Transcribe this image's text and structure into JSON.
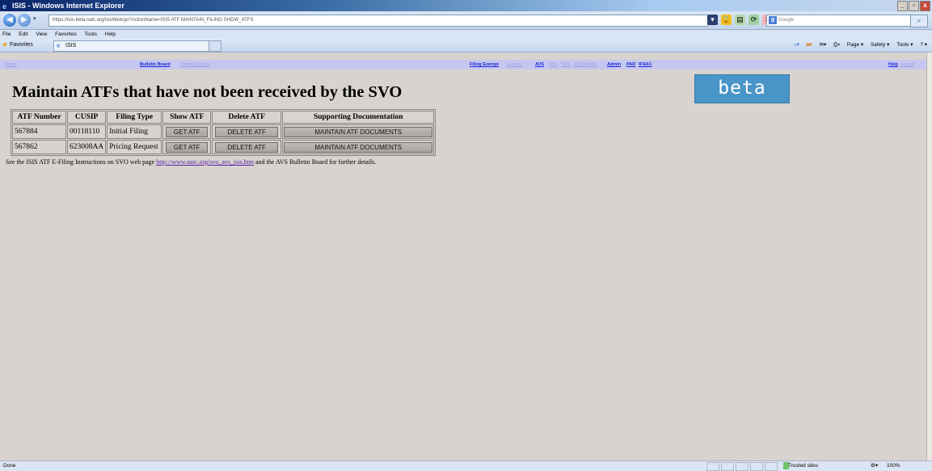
{
  "window": {
    "title": "ISIS - Windows Internet Explorer",
    "min": "_",
    "max": "▫",
    "close": "x"
  },
  "address_bar": {
    "url": "https://isis-beta.naic.org/isisWeb/go?ActionName=ISIS ATF MAINTAIN_FILING SHOW_ATFS",
    "search_placeholder": "Google",
    "search_logo": "g"
  },
  "menu": [
    "File",
    "Edit",
    "View",
    "Favorites",
    "Tools",
    "Help"
  ],
  "favorites_bar": {
    "favorites_label": "Favorites",
    "tab_label": "ISIS",
    "commands": [
      "Page ▾",
      "Safety ▾",
      "Tools ▾",
      "? ▾"
    ]
  },
  "nav": {
    "home": "Home",
    "bulletin_board": "Bulletin Board",
    "vendor_service": "Vendor Service",
    "filing_exempt": "Filing Exempt",
    "generic": "Generic",
    "avs": "AVS",
    "atf": "ATF",
    "vos": "VOS",
    "vos_admin": "VOS Admin",
    "admin": "Admin",
    "par": "PAR",
    "ifsac": "IFSAC",
    "help": "Help",
    "logout": "Logout"
  },
  "page": {
    "title": "Maintain ATFs that have not been received by the SVO",
    "badge": "beta"
  },
  "table": {
    "headers": [
      "ATF Number",
      "CUSIP",
      "Filing Type",
      "Show ATF",
      "Delete ATF",
      "Supporting Documentation"
    ],
    "rows": [
      {
        "atf_number": "567884",
        "cusip": "00118110",
        "filing_type": "Initial Filing",
        "show": "GET ATF",
        "delete": "DELETE ATF",
        "docs": "MAINTAIN ATF DOCUMENTS"
      },
      {
        "atf_number": "567862",
        "cusip": "623008AA",
        "filing_type": "Pricing Request",
        "show": "GET ATF",
        "delete": "DELETE ATF",
        "docs": "MAINTAIN ATF DOCUMENTS"
      }
    ]
  },
  "footer": {
    "text_before": "See the ISIS ATF E-Filing Instructions on SVO web page ",
    "link": "http://www.naic.org/svo_avs_isis.htm",
    "text_after": " and the AVS Bulletin Board for further details."
  },
  "status_bar": {
    "status": "Done",
    "zone": "Trusted sites",
    "zoom": "100%"
  }
}
